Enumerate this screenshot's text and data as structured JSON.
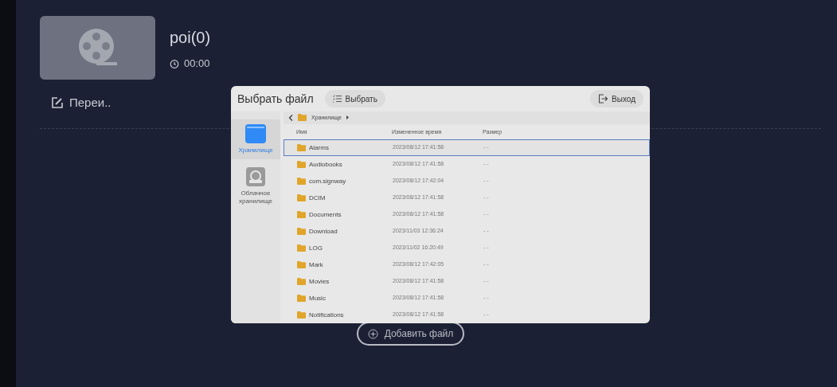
{
  "media_card": {
    "title": "poi(0)",
    "duration": "00:00",
    "rename_label": "Переи.."
  },
  "add_file_button": "Добавить файл",
  "dialog": {
    "title": "Выбрать файл",
    "select_button": "Выбрать",
    "exit_button": "Выход",
    "sidebar": [
      {
        "label": "Хранилище",
        "kind": "storage",
        "selected": true
      },
      {
        "label": "Облачное хранилище",
        "kind": "cloud",
        "selected": false
      }
    ],
    "breadcrumb": "Хранилище",
    "columns": [
      "Имя",
      "Измененное время",
      "Размер"
    ],
    "rows": [
      {
        "name": "Alarms",
        "modified": "2023/08/12 17:41:58",
        "size": "- -",
        "selected": true
      },
      {
        "name": "Audiobooks",
        "modified": "2023/08/12 17:41:58",
        "size": "- -",
        "selected": false
      },
      {
        "name": "com.signway",
        "modified": "2023/08/12 17:42:04",
        "size": "- -",
        "selected": false
      },
      {
        "name": "DCIM",
        "modified": "2023/08/12 17:41:58",
        "size": "- -",
        "selected": false
      },
      {
        "name": "Documents",
        "modified": "2023/08/12 17:41:58",
        "size": "- -",
        "selected": false
      },
      {
        "name": "Download",
        "modified": "2023/11/03 12:36:24",
        "size": "- -",
        "selected": false
      },
      {
        "name": "LOG",
        "modified": "2023/11/02 16:20:49",
        "size": "- -",
        "selected": false
      },
      {
        "name": "Mark",
        "modified": "2023/08/12 17:42:05",
        "size": "- -",
        "selected": false
      },
      {
        "name": "Movies",
        "modified": "2023/08/12 17:41:58",
        "size": "- -",
        "selected": false
      },
      {
        "name": "Music",
        "modified": "2023/08/12 17:41:58",
        "size": "- -",
        "selected": false
      },
      {
        "name": "Notifications",
        "modified": "2023/08/12 17:41:58",
        "size": "- -",
        "selected": false
      }
    ]
  }
}
